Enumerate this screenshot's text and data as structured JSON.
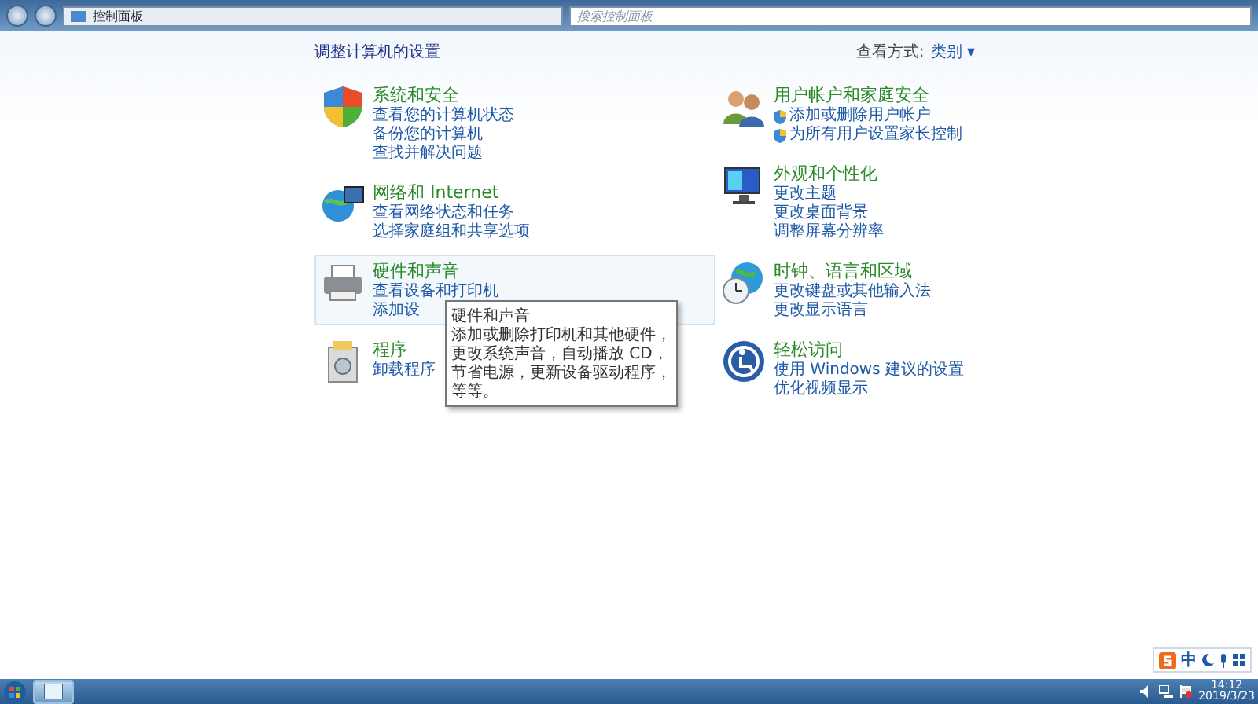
{
  "address_bar": {
    "breadcrumb": "控制面板",
    "search_placeholder": "搜索控制面板"
  },
  "header": {
    "title": "调整计算机的设置",
    "view_by_label": "查看方式:",
    "view_by_value": "类别",
    "view_by_caret": "▾"
  },
  "columns": [
    [
      {
        "title": "系统和安全",
        "hovered": false,
        "links": [
          {
            "text": "查看您的计算机状态",
            "shield": false
          },
          {
            "text": "备份您的计算机",
            "shield": false
          },
          {
            "text": "查找并解决问题",
            "shield": false
          }
        ]
      },
      {
        "title": "网络和 Internet",
        "hovered": false,
        "links": [
          {
            "text": "查看网络状态和任务",
            "shield": false
          },
          {
            "text": "选择家庭组和共享选项",
            "shield": false
          }
        ]
      },
      {
        "title": "硬件和声音",
        "hovered": true,
        "links": [
          {
            "text": "查看设备和打印机",
            "shield": false
          },
          {
            "text": "添加设",
            "shield": false
          }
        ],
        "tooltip": {
          "title": "硬件和声音",
          "body": "添加或删除打印机和其他硬件，更改系统声音，自动播放 CD，节省电源，更新设备驱动程序，等等。"
        }
      },
      {
        "title": "程序",
        "hovered": false,
        "links": [
          {
            "text": "卸载程序",
            "shield": false
          }
        ]
      }
    ],
    [
      {
        "title": "用户帐户和家庭安全",
        "hovered": false,
        "links": [
          {
            "text": "添加或删除用户帐户",
            "shield": true
          },
          {
            "text": "为所有用户设置家长控制",
            "shield": true
          }
        ]
      },
      {
        "title": "外观和个性化",
        "hovered": false,
        "links": [
          {
            "text": "更改主题",
            "shield": false
          },
          {
            "text": "更改桌面背景",
            "shield": false
          },
          {
            "text": "调整屏幕分辨率",
            "shield": false
          }
        ]
      },
      {
        "title": "时钟、语言和区域",
        "hovered": false,
        "links": [
          {
            "text": "更改键盘或其他输入法",
            "shield": false
          },
          {
            "text": "更改显示语言",
            "shield": false
          }
        ]
      },
      {
        "title": "轻松访问",
        "hovered": false,
        "links": [
          {
            "text": "使用 Windows 建议的设置",
            "shield": false
          },
          {
            "text": "优化视频显示",
            "shield": false
          }
        ]
      }
    ]
  ],
  "ime_bar": {
    "mode": "中"
  },
  "taskbar": {
    "time": "14:12",
    "date": "2019/3/23"
  }
}
